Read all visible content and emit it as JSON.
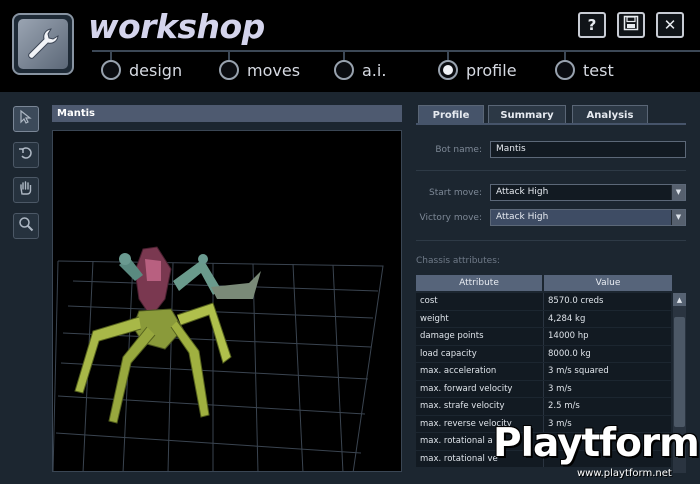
{
  "header": {
    "title": "workshop",
    "help_label": "?",
    "save_icon": "floppy-disk-icon",
    "close_label": "✕"
  },
  "nav": {
    "tabs": [
      {
        "label": "design",
        "active": false
      },
      {
        "label": "moves",
        "active": false
      },
      {
        "label": "a.i.",
        "active": false
      },
      {
        "label": "profile",
        "active": true
      },
      {
        "label": "test",
        "active": false
      }
    ]
  },
  "tools": [
    "pointer-icon",
    "rotate-icon",
    "hand-icon",
    "zoom-icon"
  ],
  "viewport": {
    "title": "Mantis"
  },
  "panel": {
    "tabs": [
      "Profile",
      "Summary",
      "Analysis"
    ],
    "active_tab": "Profile",
    "bot_name_label": "Bot name:",
    "bot_name_value": "Mantis",
    "start_move_label": "Start move:",
    "start_move_value": "Attack High",
    "victory_move_label": "Victory move:",
    "victory_move_value": "Attack High",
    "chassis_label": "Chassis attributes:",
    "col_attribute": "Attribute",
    "col_value": "Value",
    "rows": [
      {
        "attr": "cost",
        "value": "8570.0 creds"
      },
      {
        "attr": "weight",
        "value": "4,284 kg"
      },
      {
        "attr": "damage points",
        "value": "14000 hp"
      },
      {
        "attr": "load capacity",
        "value": "8000.0 kg"
      },
      {
        "attr": "max. acceleration",
        "value": "3 m/s squared"
      },
      {
        "attr": "max. forward velocity",
        "value": "3 m/s"
      },
      {
        "attr": "max. strafe velocity",
        "value": "2.5 m/s"
      },
      {
        "attr": "max. reverse velocity",
        "value": "3 m/s"
      },
      {
        "attr": "max. rotational a",
        "value": ""
      },
      {
        "attr": "max. rotational ve",
        "value": ""
      }
    ]
  },
  "watermark": {
    "brand": "Playtform",
    "url": "www.playtform.net"
  }
}
